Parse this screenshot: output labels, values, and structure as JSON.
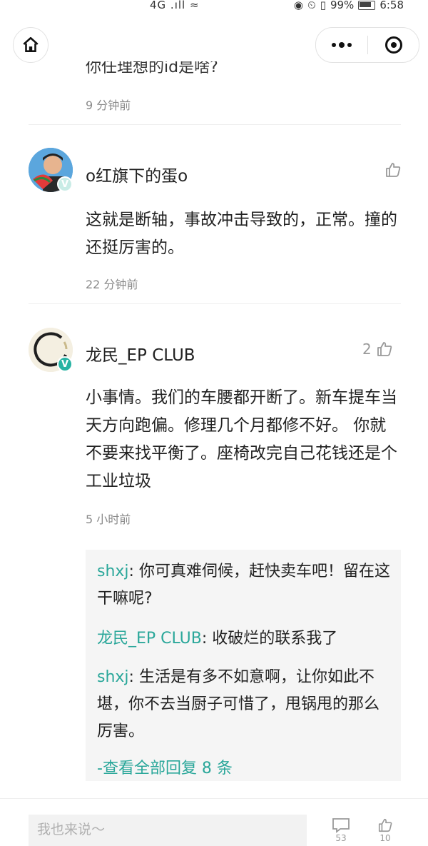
{
  "status_bar": {
    "signal": "4G .ıll ≈",
    "battery": "99%",
    "time": "6:58",
    "icons": [
      "eye-icon",
      "alarm-icon",
      "vibrate-icon",
      "battery-icon"
    ]
  },
  "nav": {
    "home_icon": "home-icon",
    "more_icon": "more-dots-icon",
    "close_icon": "target-close-icon"
  },
  "top_partial": {
    "text": "你任理想的id是啥?",
    "time": "9 分钟前"
  },
  "comments": [
    {
      "username": "o红旗下的蛋o",
      "text": "这就是断轴，事故冲击导致的，正常。撞的还挺厉害的。",
      "time": "22 分钟前",
      "likes": ""
    },
    {
      "username": "龙民_EP CLUB",
      "text": "小事情。我们的车腰都开断了。新车提车当天方向跑偏。修理几个月都修不好。 你就不要来找平衡了。座椅改完自己花钱还是个工业垃圾",
      "time": "5 小时前",
      "likes": "2"
    }
  ],
  "replies": [
    {
      "author": "shxj",
      "text": ": 你可真难伺候，赶快卖车吧！留在这干嘛呢?"
    },
    {
      "author": "龙民_EP CLUB",
      "text": ": 收破烂的联系我了"
    },
    {
      "author": "shxj",
      "text": ": 生活是有多不如意啊，让你如此不堪，你不去当厨子可惜了，甩锅甩的那么厉害。"
    }
  ],
  "view_all_replies": "-查看全部回复 8 条",
  "bottom": {
    "input_placeholder": "我也来说～",
    "comment_count": "53",
    "like_count": "10"
  },
  "colors": {
    "accent": "#2aa79a",
    "badge": "#27b3a3",
    "muted": "#8a8a8a"
  }
}
